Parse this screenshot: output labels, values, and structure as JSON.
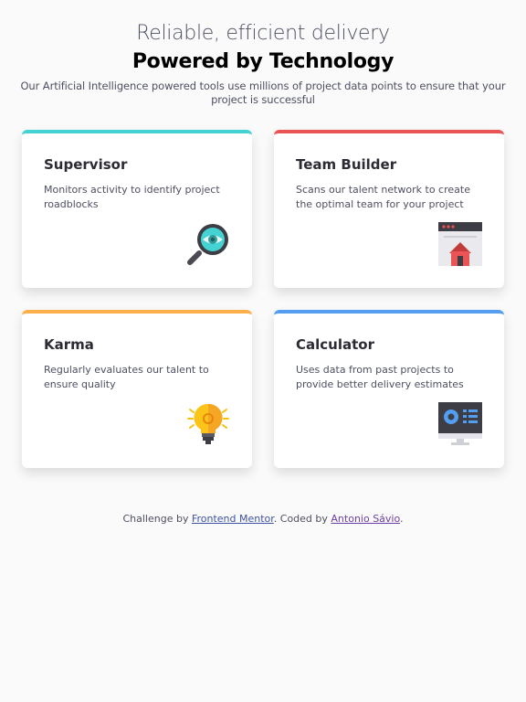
{
  "header": {
    "subtitle": "Reliable, efficient delivery",
    "title": "Powered by Technology",
    "intro": "Our Artificial Intelligence powered tools use millions of project data points to ensure that your project is successful"
  },
  "cards": [
    {
      "title": "Supervisor",
      "text": "Monitors activity to identify project roadblocks",
      "accent": "#44d3d2",
      "icon": "magnifier-eye-icon"
    },
    {
      "title": "Team Builder",
      "text": "Scans our talent network to create the optimal team for your project",
      "accent": "#ea5454",
      "icon": "browser-house-icon"
    },
    {
      "title": "Karma",
      "text": "Regularly evaluates our talent to ensure quality",
      "accent": "#fcaf4a",
      "icon": "lightbulb-icon"
    },
    {
      "title": "Calculator",
      "text": "Uses data from past projects to provide better delivery estimates",
      "accent": "#549ef2",
      "icon": "monitor-chart-icon"
    }
  ],
  "footer": {
    "prefix": "Challenge by ",
    "link1": "Frontend Mentor",
    "middle": ". Coded by ",
    "link2": "Antonio Sávio",
    "suffix": "."
  }
}
